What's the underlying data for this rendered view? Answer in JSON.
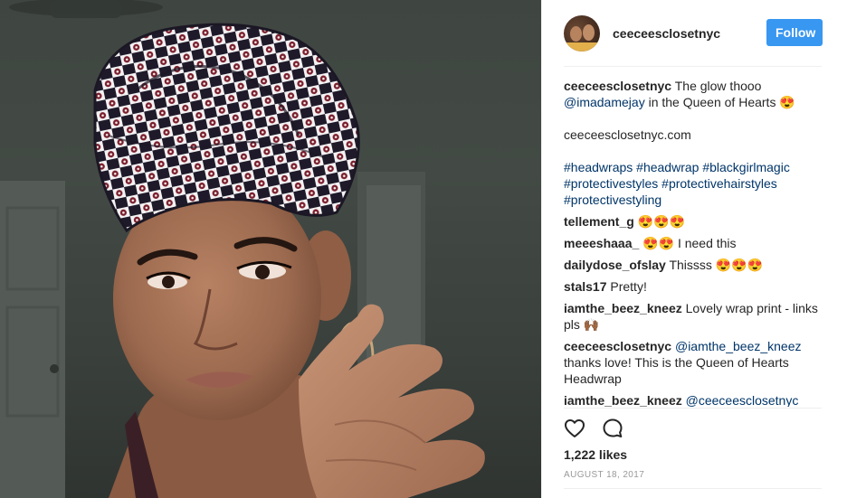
{
  "post": {
    "owner_username": "ceeceesclosetnyc",
    "follow_label": "Follow",
    "caption": {
      "username": "ceeceesclosetnyc",
      "text_before_mention": "The glow thooo",
      "mention": "@imadamejay",
      "text_after_mention": "in the Queen of Hearts",
      "emoji": "😍",
      "website": "ceeceesclosetnyc.com",
      "hashtag_line_1": "#headwraps #headwrap #blackgirlmagic",
      "hashtag_line_2": "#protectivestyles #protectivehairstyles",
      "hashtag_line_3": "#protectivestyling"
    },
    "comments": [
      {
        "username": "tellement_g",
        "text": "😍😍😍"
      },
      {
        "username": "meeeshaaa_",
        "text": "😍😍 I need this"
      },
      {
        "username": "dailydose_ofslay",
        "text": "Thissss 😍😍😍"
      },
      {
        "username": "stals17",
        "text": "Pretty!"
      },
      {
        "username": "iamthe_beez_kneez",
        "text": "Lovely wrap print - links pls 🙌🏾"
      },
      {
        "username": "ceeceesclosetnyc",
        "mention": "@iamthe_beez_kneez",
        "text": "thanks love! This is the Queen of Hearts Headwrap"
      },
      {
        "username": "iamthe_beez_kneez",
        "mention": "@ceeceesclosetnyc",
        "text": ""
      }
    ],
    "actions": {
      "like_icon": "heart-outline-icon",
      "comment_icon": "speech-bubble-icon"
    },
    "likes": "1,222 likes",
    "date": "AUGUST 18, 2017"
  },
  "colors": {
    "follow_button": "#3897f0",
    "link": "#003569",
    "text": "#262626",
    "muted": "#999999"
  }
}
